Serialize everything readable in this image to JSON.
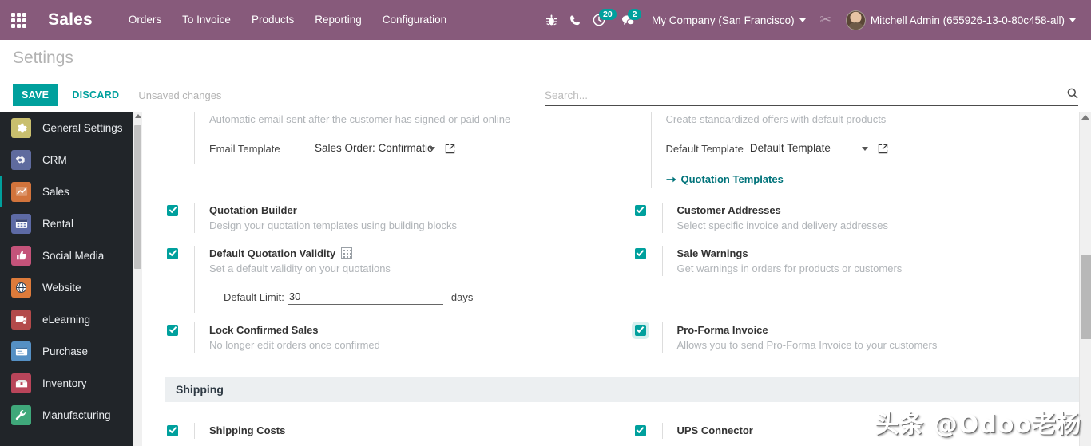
{
  "navbar": {
    "apps_icon": "apps-grid-icon",
    "brand": "Sales",
    "menu": [
      {
        "label": "Orders"
      },
      {
        "label": "To Invoice"
      },
      {
        "label": "Products"
      },
      {
        "label": "Reporting"
      },
      {
        "label": "Configuration"
      }
    ],
    "bug_icon": "bug-icon",
    "phone_icon": "phone-icon",
    "activity_icon": "clock-activity-icon",
    "activity_count": "20",
    "messages_icon": "chat-bubble-icon",
    "messages_count": "2",
    "company": "My Company (San Francisco)",
    "scissors_icon": "scissors-icon",
    "user": "Mitchell Admin (655926-13-0-80c458-all)",
    "bg_color": "#875a7b"
  },
  "control_panel": {
    "title": "Settings",
    "save_label": "SAVE",
    "discard_label": "DISCARD",
    "unsaved_label": "Unsaved changes",
    "accent_color": "#00a09d"
  },
  "search": {
    "placeholder": "Search...",
    "value": "",
    "icon": "search-icon"
  },
  "sidebar": {
    "items": [
      {
        "label": "General Settings",
        "icon": "gear-icon",
        "active": false
      },
      {
        "label": "CRM",
        "icon": "handshake-icon",
        "active": false
      },
      {
        "label": "Sales",
        "icon": "chart-line-icon",
        "active": true
      },
      {
        "label": "Rental",
        "icon": "calendar-icon",
        "active": false
      },
      {
        "label": "Social Media",
        "icon": "thumbs-up-icon",
        "active": false
      },
      {
        "label": "Website",
        "icon": "globe-icon",
        "active": false
      },
      {
        "label": "eLearning",
        "icon": "graduation-icon",
        "active": false
      },
      {
        "label": "Purchase",
        "icon": "card-icon",
        "active": false
      },
      {
        "label": "Inventory",
        "icon": "box-icon",
        "active": false
      },
      {
        "label": "Manufacturing",
        "icon": "wrench-icon",
        "active": false
      }
    ]
  },
  "settings": {
    "online_signature_desc": "Automatic email sent after the customer has signed or paid online",
    "email_template_label": "Email Template",
    "email_template_value": "Sales Order: Confirmatic",
    "email_template_ext_icon": "external-link-icon",
    "quotation_templates_desc": "Create standardized offers with default products",
    "default_template_label": "Default Template",
    "default_template_value": "Default Template",
    "default_template_ext_icon": "external-link-icon",
    "quotation_templates_link": "Quotation Templates",
    "quotation_templates_link_icon": "arrow-right-icon",
    "rows": [
      {
        "left": {
          "title": "Quotation Builder",
          "desc": "Design your quotation templates using building blocks",
          "checked": true,
          "focused": false,
          "company_icon": false
        },
        "right": {
          "title": "Customer Addresses",
          "desc": "Select specific invoice and delivery addresses",
          "checked": true,
          "focused": false,
          "company_icon": false
        }
      },
      {
        "left": {
          "title": "Default Quotation Validity",
          "desc": "Set a default validity on your quotations",
          "checked": true,
          "focused": false,
          "company_icon": true
        },
        "right": {
          "title": "Sale Warnings",
          "desc": "Get warnings in orders for products or customers",
          "checked": true,
          "focused": false,
          "company_icon": false
        }
      },
      {
        "left": {
          "title": "Lock Confirmed Sales",
          "desc": "No longer edit orders once confirmed",
          "checked": true,
          "focused": false,
          "company_icon": false
        },
        "right": {
          "title": "Pro-Forma Invoice",
          "desc": "Allows you to send Pro-Forma Invoice to your customers",
          "checked": true,
          "focused": true,
          "company_icon": false
        }
      }
    ],
    "default_limit_label": "Default Limit:",
    "default_limit_value": "30",
    "default_limit_unit": "days",
    "shipping_section": "Shipping",
    "shipping_rows": [
      {
        "left": {
          "title": "Shipping Costs",
          "checked": true
        },
        "right": {
          "title": "UPS Connector",
          "checked": true
        }
      }
    ]
  },
  "watermark": "头条 @Odoo老杨"
}
